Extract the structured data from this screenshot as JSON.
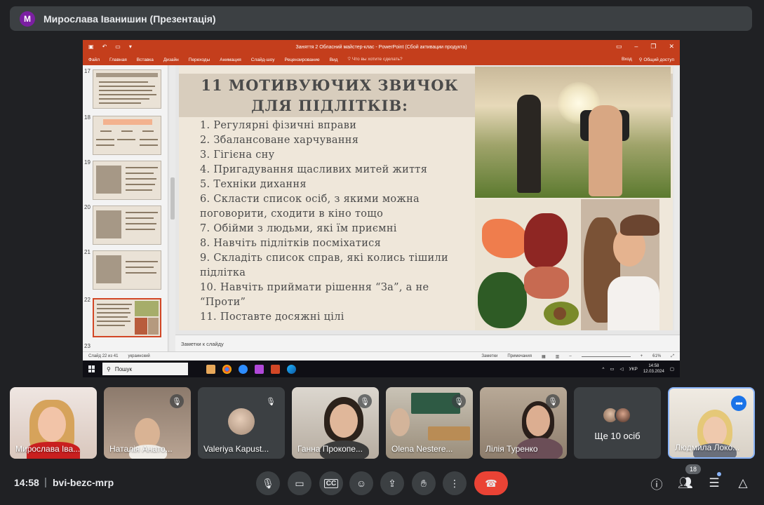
{
  "presenter": {
    "avatar_letter": "M",
    "name": "Мирослава Іванишин (Презентація)"
  },
  "powerpoint": {
    "window_title": "Заняття 2 Обласний майстер-клас - PowerPoint (Сбой активации продукта)",
    "ribbon_tabs": [
      "Файл",
      "Главная",
      "Вставка",
      "Дизайн",
      "Переходы",
      "Анимация",
      "Слайд-шоу",
      "Рецензирование",
      "Вид"
    ],
    "tell_me": "Что вы хотите сделать?",
    "sign_in": "Вход",
    "share": "Общий доступ",
    "thumb_numbers": [
      "17",
      "18",
      "19",
      "20",
      "21",
      "22",
      "23"
    ],
    "notes_placeholder": "Заметки к слайду",
    "status_slide": "Слайд 22 из 41",
    "status_lang": "украинский",
    "status_notes": "Заметки",
    "status_comments": "Примечания",
    "zoom": "61%"
  },
  "slide": {
    "title": "11 МОТИВУЮЧИХ ЗВИЧОК ДЛЯ ПІДЛІТКІВ:",
    "items": [
      "1. Регулярні фізичні вправи",
      "2. Збалансоване харчування",
      "3. Гігієна сну",
      "4. Пригадування щасливих митей життя",
      "5. Техніки дихання",
      "6. Скласти список осіб, з якими можна поговорити, сходити в кіно тощо",
      "7. Обійми з людьми, які їм приємні",
      "8. Навчіть підлітків посміхатися",
      "9. Складіть список справ, які колись тішили підлітка",
      "10. Навчіть приймати рішення “За”, а не “Проти”",
      "11. Поставте досяжні цілі"
    ]
  },
  "taskbar": {
    "search": "Пошук",
    "lang": "УКР",
    "time": "14:58",
    "date": "12.03.2024"
  },
  "participants": [
    {
      "name": "Мирослава Іва...",
      "muted": false
    },
    {
      "name": "Наталія Анато...",
      "muted": true
    },
    {
      "name": "Valeriya Kapust...",
      "muted": true
    },
    {
      "name": "Ганна Прокопе...",
      "muted": true
    },
    {
      "name": "Olena Nestere...",
      "muted": true
    },
    {
      "name": "Лілія Туренко",
      "muted": true
    },
    {
      "name": "Ще 10 осіб",
      "muted": false
    },
    {
      "name": "Людмила Локо...",
      "muted": false
    }
  ],
  "meeting": {
    "time": "14:58",
    "code": "bvi-bezc-mrp",
    "people_count": "18"
  }
}
